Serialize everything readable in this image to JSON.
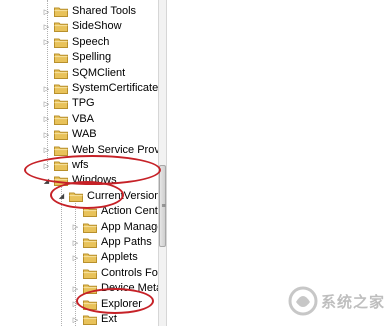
{
  "tree": {
    "items": [
      {
        "label": "Shared Tools",
        "level": 0,
        "expanded": false,
        "has_children": true
      },
      {
        "label": "SideShow",
        "level": 0,
        "expanded": false,
        "has_children": true
      },
      {
        "label": "Speech",
        "level": 0,
        "expanded": false,
        "has_children": true
      },
      {
        "label": "Spelling",
        "level": 0,
        "expanded": false,
        "has_children": false
      },
      {
        "label": "SQMClient",
        "level": 0,
        "expanded": false,
        "has_children": false
      },
      {
        "label": "SystemCertificates",
        "level": 0,
        "expanded": false,
        "has_children": true
      },
      {
        "label": "TPG",
        "level": 0,
        "expanded": false,
        "has_children": true
      },
      {
        "label": "VBA",
        "level": 0,
        "expanded": false,
        "has_children": true
      },
      {
        "label": "WAB",
        "level": 0,
        "expanded": false,
        "has_children": true
      },
      {
        "label": "Web Service Providers",
        "level": 0,
        "expanded": false,
        "has_children": true
      },
      {
        "label": "wfs",
        "level": 0,
        "expanded": false,
        "has_children": true
      },
      {
        "label": "Windows",
        "level": 0,
        "expanded": true,
        "has_children": true
      },
      {
        "label": "CurrentVersion",
        "level": 1,
        "expanded": true,
        "has_children": true
      },
      {
        "label": "Action Center",
        "level": 2,
        "expanded": false,
        "has_children": false
      },
      {
        "label": "App Management",
        "level": 2,
        "expanded": false,
        "has_children": true
      },
      {
        "label": "App Paths",
        "level": 2,
        "expanded": false,
        "has_children": true
      },
      {
        "label": "Applets",
        "level": 2,
        "expanded": false,
        "has_children": true
      },
      {
        "label": "Controls Folder",
        "level": 2,
        "expanded": false,
        "has_children": false
      },
      {
        "label": "Device Metadata",
        "level": 2,
        "expanded": false,
        "has_children": true
      },
      {
        "label": "Explorer",
        "level": 2,
        "expanded": false,
        "has_children": true
      },
      {
        "label": "Ext",
        "level": 2,
        "expanded": false,
        "has_children": true
      }
    ]
  },
  "icons": {
    "folder": "folder-icon",
    "collapsed": "expand-arrow-icon",
    "expanded": "collapse-arrow-icon"
  },
  "colors": {
    "folder_fill": "#e8c25a",
    "folder_edge": "#b8902c",
    "annotation": "#c62127"
  },
  "watermark": {
    "text": "系统之家"
  }
}
